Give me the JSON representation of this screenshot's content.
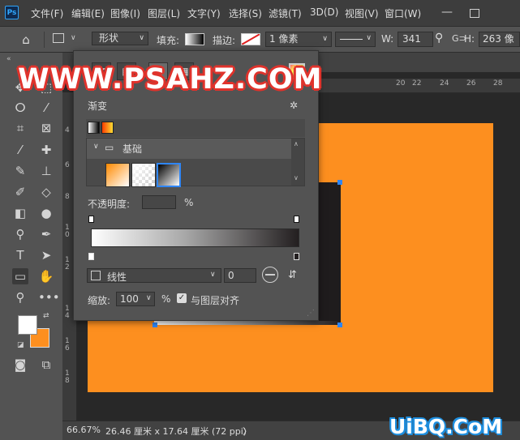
{
  "app": {
    "logo": "Ps"
  },
  "menu": [
    "文件(F)",
    "编辑(E)",
    "图像(I)",
    "图层(L)",
    "文字(Y)",
    "选择(S)",
    "滤镜(T)",
    "3D(D)",
    "视图(V)",
    "窗口(W)"
  ],
  "options": {
    "shape_mode": "形状",
    "fill_label": "填充:",
    "stroke_label": "描边:",
    "stroke_width": "1 像素",
    "w_label": "W:",
    "w_value": "341 像",
    "link_label": "G⊃",
    "h_label": "H:",
    "h_value": "263 像"
  },
  "ruler_top": [
    "20",
    "22",
    "24",
    "26",
    "28"
  ],
  "ruler_left": [
    "4",
    "6",
    "8",
    "1\n0",
    "1\n2",
    "1\n4",
    "1\n6",
    "1\n8"
  ],
  "status": {
    "zoom": "66.67%",
    "doc_size": "26.46 厘米 x 17.64 厘米 (72 ppi)"
  },
  "panel": {
    "title": "渐变",
    "folder_name": "基础",
    "opacity_label": "不透明度:",
    "opacity_unit": "%",
    "style_value": "线性",
    "angle_value": "0",
    "scale_label": "缩放:",
    "scale_value": "100",
    "scale_unit": "%",
    "align_label": "与图层对齐",
    "align_checked": true
  },
  "colors": {
    "foreground": "#ffffff",
    "background": "#fd8f1f",
    "canvas_fill": "#fd8f1f",
    "gradient_start": "#ffffff",
    "gradient_end": "#231f20",
    "selection_handle": "#2f86f6"
  },
  "watermarks": {
    "top": "WWW.PSAHZ.COM",
    "bottom": "UiBQ.CoM"
  }
}
